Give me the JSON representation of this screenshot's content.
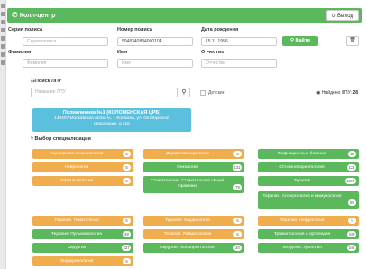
{
  "header": {
    "title": "Колл-центр",
    "logout_label": "Выход"
  },
  "policy": {
    "series_label": "Серия полиса",
    "series_placeholder": "Серия полиса",
    "number_label": "Номер полиса",
    "number_value": "5048340834000104",
    "birth_label": "Дата рождения",
    "birth_value": "15.11.1956",
    "find_label": "Найти",
    "surname_label": "Фамилия",
    "surname_placeholder": "Фамилия",
    "name_label": "Имя",
    "name_placeholder": "Имя",
    "patronymic_label": "Отчество",
    "patronymic_placeholder": "Отчество"
  },
  "lpu_search": {
    "title": "Поиск ЛПУ",
    "placeholder": "Название ЛПУ",
    "children_label": "Детские",
    "found_label": "Найдено ЛПУ:",
    "found_count": "28",
    "selected_name": "Поликлиника №1 (КОЛОМЕНСКАЯ ЦРБ)",
    "selected_address": "140407 Московская область, г. Коломна, ул. Октябрьской революции, д.318"
  },
  "specialization": {
    "title": "Выбор специализации",
    "items": [
      {
        "label": "Акушерство и гинекология",
        "count": "5",
        "color": "#f0ad4e"
      },
      {
        "label": "Дерматовенерология",
        "count": "5",
        "color": "#f0ad4e"
      },
      {
        "label": "Инфекционные болезни",
        "count": "19",
        "color": "#5cb85c"
      },
      {
        "label": "Неврология",
        "count": "5",
        "color": "#f0ad4e"
      },
      {
        "label": "Онкология",
        "count": "131",
        "color": "#5cb85c"
      },
      {
        "label": "Оториноларингология",
        "count": "123",
        "color": "#5cb85c"
      },
      {
        "label": "Офтальмология",
        "count": "5",
        "color": "#f0ad4e"
      },
      {
        "label": "Стоматология. Стоматология общей практики",
        "count": "79",
        "color": "#5cb85c"
      },
      {
        "label": "Терапия",
        "count": "1377",
        "color": "#5cb85c"
      },
      {
        "label": "Терапия. Аллергология и иммунология",
        "count": "84",
        "color": "#5cb85c"
      },
      {
        "label": "Терапия. Гематология",
        "count": "5",
        "color": "#f0ad4e"
      },
      {
        "label": "Терапия. Кардиология",
        "count": "5",
        "color": "#f0ad4e"
      },
      {
        "label": "Терапия. Нефрология",
        "count": "5",
        "color": "#f0ad4e"
      },
      {
        "label": "Терапия. Пульмонология",
        "count": "48",
        "color": "#5cb85c"
      },
      {
        "label": "Терапия. Ревматология",
        "count": "5",
        "color": "#f0ad4e"
      },
      {
        "label": "Травматология и ортопедия",
        "count": "449",
        "color": "#5cb85c"
      },
      {
        "label": "Хирургия",
        "count": "327",
        "color": "#5cb85c"
      },
      {
        "label": "Хирургия. Колопроктология",
        "count": "20",
        "color": "#5cb85c"
      },
      {
        "label": "Хирургия. Урология",
        "count": "246",
        "color": "#5cb85c"
      },
      {
        "label": "Эндокринология",
        "count": "5",
        "color": "#f0ad4e"
      }
    ]
  },
  "icons": [
    "phone-icon",
    "power-icon",
    "search-icon",
    "trash-icon",
    "eye-icon",
    "hospital-icon",
    "stethoscope-icon"
  ]
}
